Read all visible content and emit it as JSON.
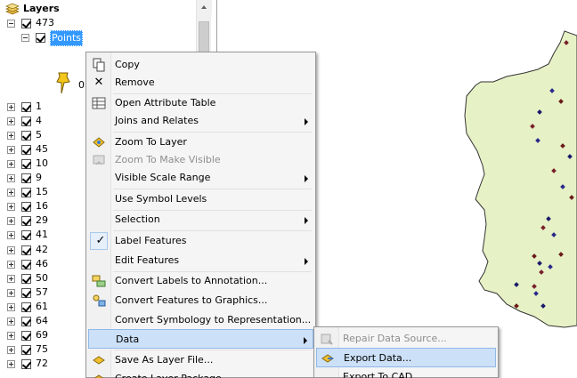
{
  "toc": {
    "root_label": "Layers",
    "group_label": "473",
    "selected_layer_label": "Points",
    "symbol_label": "0",
    "layers": [
      "1",
      "4",
      "5",
      "45",
      "10",
      "9",
      "15",
      "16",
      "29",
      "41",
      "42",
      "46",
      "50",
      "57",
      "61",
      "64",
      "69",
      "75",
      "72"
    ]
  },
  "context_menu": {
    "copy": "Copy",
    "remove": "Remove",
    "open_attribute_table": "Open Attribute Table",
    "joins_and_relates": "Joins and Relates",
    "zoom_to_layer": "Zoom To Layer",
    "zoom_to_make_visible": "Zoom To Make Visible",
    "visible_scale_range": "Visible Scale Range",
    "use_symbol_levels": "Use Symbol Levels",
    "selection": "Selection",
    "label_features": "Label Features",
    "edit_features": "Edit Features",
    "convert_labels_to_annotation": "Convert Labels to Annotation...",
    "convert_features_to_graphics": "Convert Features to Graphics...",
    "convert_symbology_to_representation": "Convert Symbology to Representation...",
    "data": "Data",
    "save_as_layer_file": "Save As Layer File...",
    "create_layer_package": "Create Layer Package..."
  },
  "data_submenu": {
    "repair_data_source": "Repair Data Source...",
    "export_data": "Export Data...",
    "export_to_cad": "Export To CAD..."
  },
  "colors": {
    "map_fill": "#e6f2c6",
    "menu_highlight": "#cce0f7",
    "selection_blue": "#3399ff"
  }
}
